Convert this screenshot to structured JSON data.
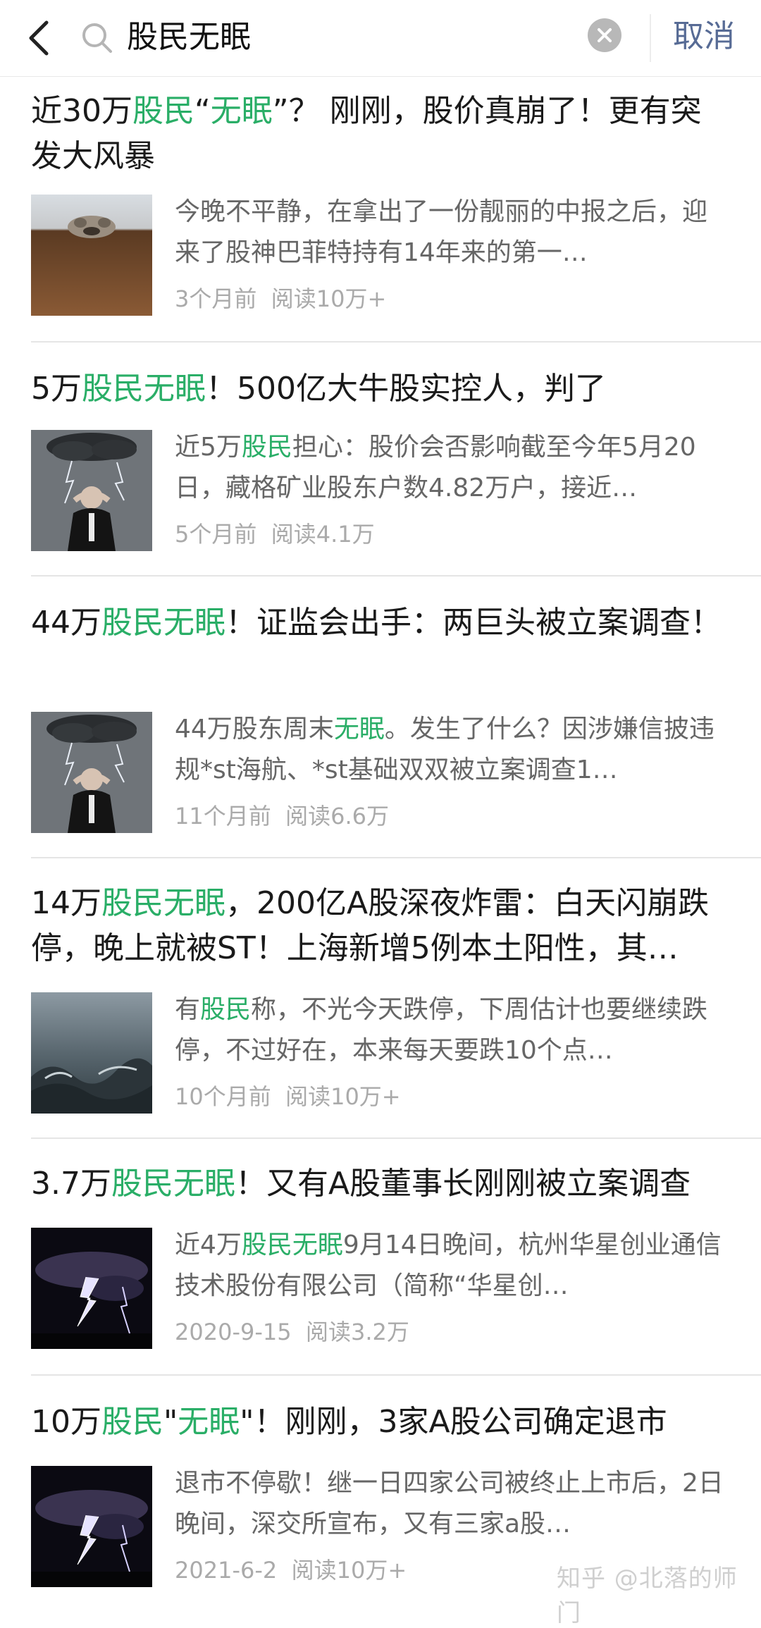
{
  "search": {
    "query": "股民无眠",
    "cancel_label": "取消"
  },
  "colors": {
    "highlight": "#2aae67",
    "cancel": "#576b95"
  },
  "results": [
    {
      "title_parts": [
        "近30万",
        "股民",
        "“",
        "无眠",
        "”？ 刚刚，股价真崩了！更有突发大风暴"
      ],
      "title_hl": [
        false,
        true,
        false,
        true,
        false
      ],
      "summary_parts": [
        "今晚不平静，在拿出了一份靓丽的中报之后，迎来了股神巴菲特持有14年来的第一…"
      ],
      "summary_hl": [
        false
      ],
      "time": "3个月前",
      "reads": "阅读10万+",
      "thumb": "dog-on-table"
    },
    {
      "title_parts": [
        "5万",
        "股民无眠",
        "！500亿大牛股实控人，判了"
      ],
      "title_hl": [
        false,
        true,
        false
      ],
      "summary_parts": [
        "近5万",
        "股民",
        "担心：股价会否影响截至今年5月20日，藏格矿业股东户数4.82万户，接近…"
      ],
      "summary_hl": [
        false,
        true,
        false
      ],
      "time": "5个月前",
      "reads": "阅读4.1万",
      "thumb": "storm-man"
    },
    {
      "title_parts": [
        "44万",
        "股民无眠",
        "！证监会出手：两巨头被立案调查！"
      ],
      "title_hl": [
        false,
        true,
        false
      ],
      "summary_parts": [
        "44万股东周末",
        "无眠",
        "。发生了什么？因涉嫌信披违规*st海航、*st基础双双被立案调查1…"
      ],
      "summary_hl": [
        false,
        true,
        false
      ],
      "time": "11个月前",
      "reads": "阅读6.6万",
      "thumb": "storm-man"
    },
    {
      "title_parts": [
        "14万",
        "股民无眠",
        "，200亿A股深夜炸雷：白天闪崩跌停，晚上就被ST！上海新增5例本土阳性，其…"
      ],
      "title_hl": [
        false,
        true,
        false
      ],
      "summary_parts": [
        "有",
        "股民",
        "称，不光今天跌停，下周估计也要继续跌停，不过好在，本来每天要跌10个点…"
      ],
      "summary_hl": [
        false,
        true,
        false
      ],
      "time": "10个月前",
      "reads": "阅读10万+",
      "thumb": "stormy-sea"
    },
    {
      "title_parts": [
        "3.7万",
        "股民无眠",
        "！又有A股董事长刚刚被立案调查"
      ],
      "title_hl": [
        false,
        true,
        false
      ],
      "summary_parts": [
        "近4万",
        "股民无眠",
        "9月14日晚间，杭州华星创业通信技术股份有限公司（简称“华星创…"
      ],
      "summary_hl": [
        false,
        true,
        false
      ],
      "time": "2020-9-15",
      "reads": "阅读3.2万",
      "thumb": "lightning"
    },
    {
      "title_parts": [
        "10万",
        "股民",
        "\"",
        "无眠",
        "\"！刚刚，3家A股公司确定退市"
      ],
      "title_hl": [
        false,
        true,
        false,
        true,
        false
      ],
      "summary_parts": [
        "退市不停歇！继一日四家公司被终止上市后，2日晚间，深交所宣布，又有三家a股…"
      ],
      "summary_hl": [
        false
      ],
      "time": "2021-6-2",
      "reads": "阅读10万+",
      "thumb": "lightning"
    }
  ],
  "watermark": "知乎 @北落的师门"
}
